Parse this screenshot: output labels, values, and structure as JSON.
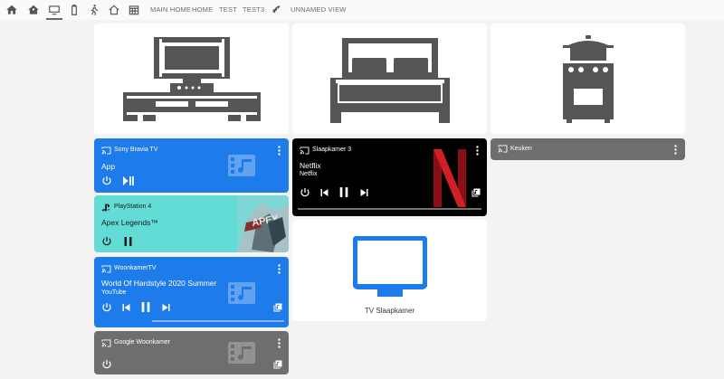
{
  "topbar": {
    "icons": [
      "home-icon",
      "home-icon",
      "monitor-icon",
      "battery-icon",
      "running-person-icon",
      "house-icon",
      "calendar-icon"
    ],
    "views": [
      "MAIN HOME",
      "HOME",
      "TEST",
      "TEST3"
    ],
    "extra_icon": "rocket-icon",
    "extra_view": "UNNAMED VIEW"
  },
  "pictures": {
    "living": "tv-furniture-icon",
    "bedroom": "bed-icon",
    "kitchen": "stove-icon"
  },
  "cards": {
    "sony": {
      "name": "Sony Bravia TV",
      "title": "App",
      "icon": "cast-icon"
    },
    "ps4": {
      "name": "PlayStation 4",
      "title": "Apex Legends™",
      "icon": "playstation-icon"
    },
    "woonkamer_tv": {
      "name": "WoonkamerTV",
      "title": "World Of Hardstyle 2020 Summer",
      "subtitle": "YouTube",
      "progress": 0.0
    },
    "google": {
      "name": "Google Woonkamer"
    },
    "slaapkamer3": {
      "name": "Slaapkamer 3",
      "title": "Netflix",
      "subtitle": "Netflix",
      "progress": 0.0
    },
    "keuken": {
      "name": "Keuken"
    },
    "tv_slaapkamer": {
      "label": "TV Slaapkamer"
    }
  },
  "colors": {
    "blue": "#1e7bea",
    "grey": "#6e6e6e",
    "teal": "#62dcd5",
    "netflix_red": "#c4161c"
  }
}
